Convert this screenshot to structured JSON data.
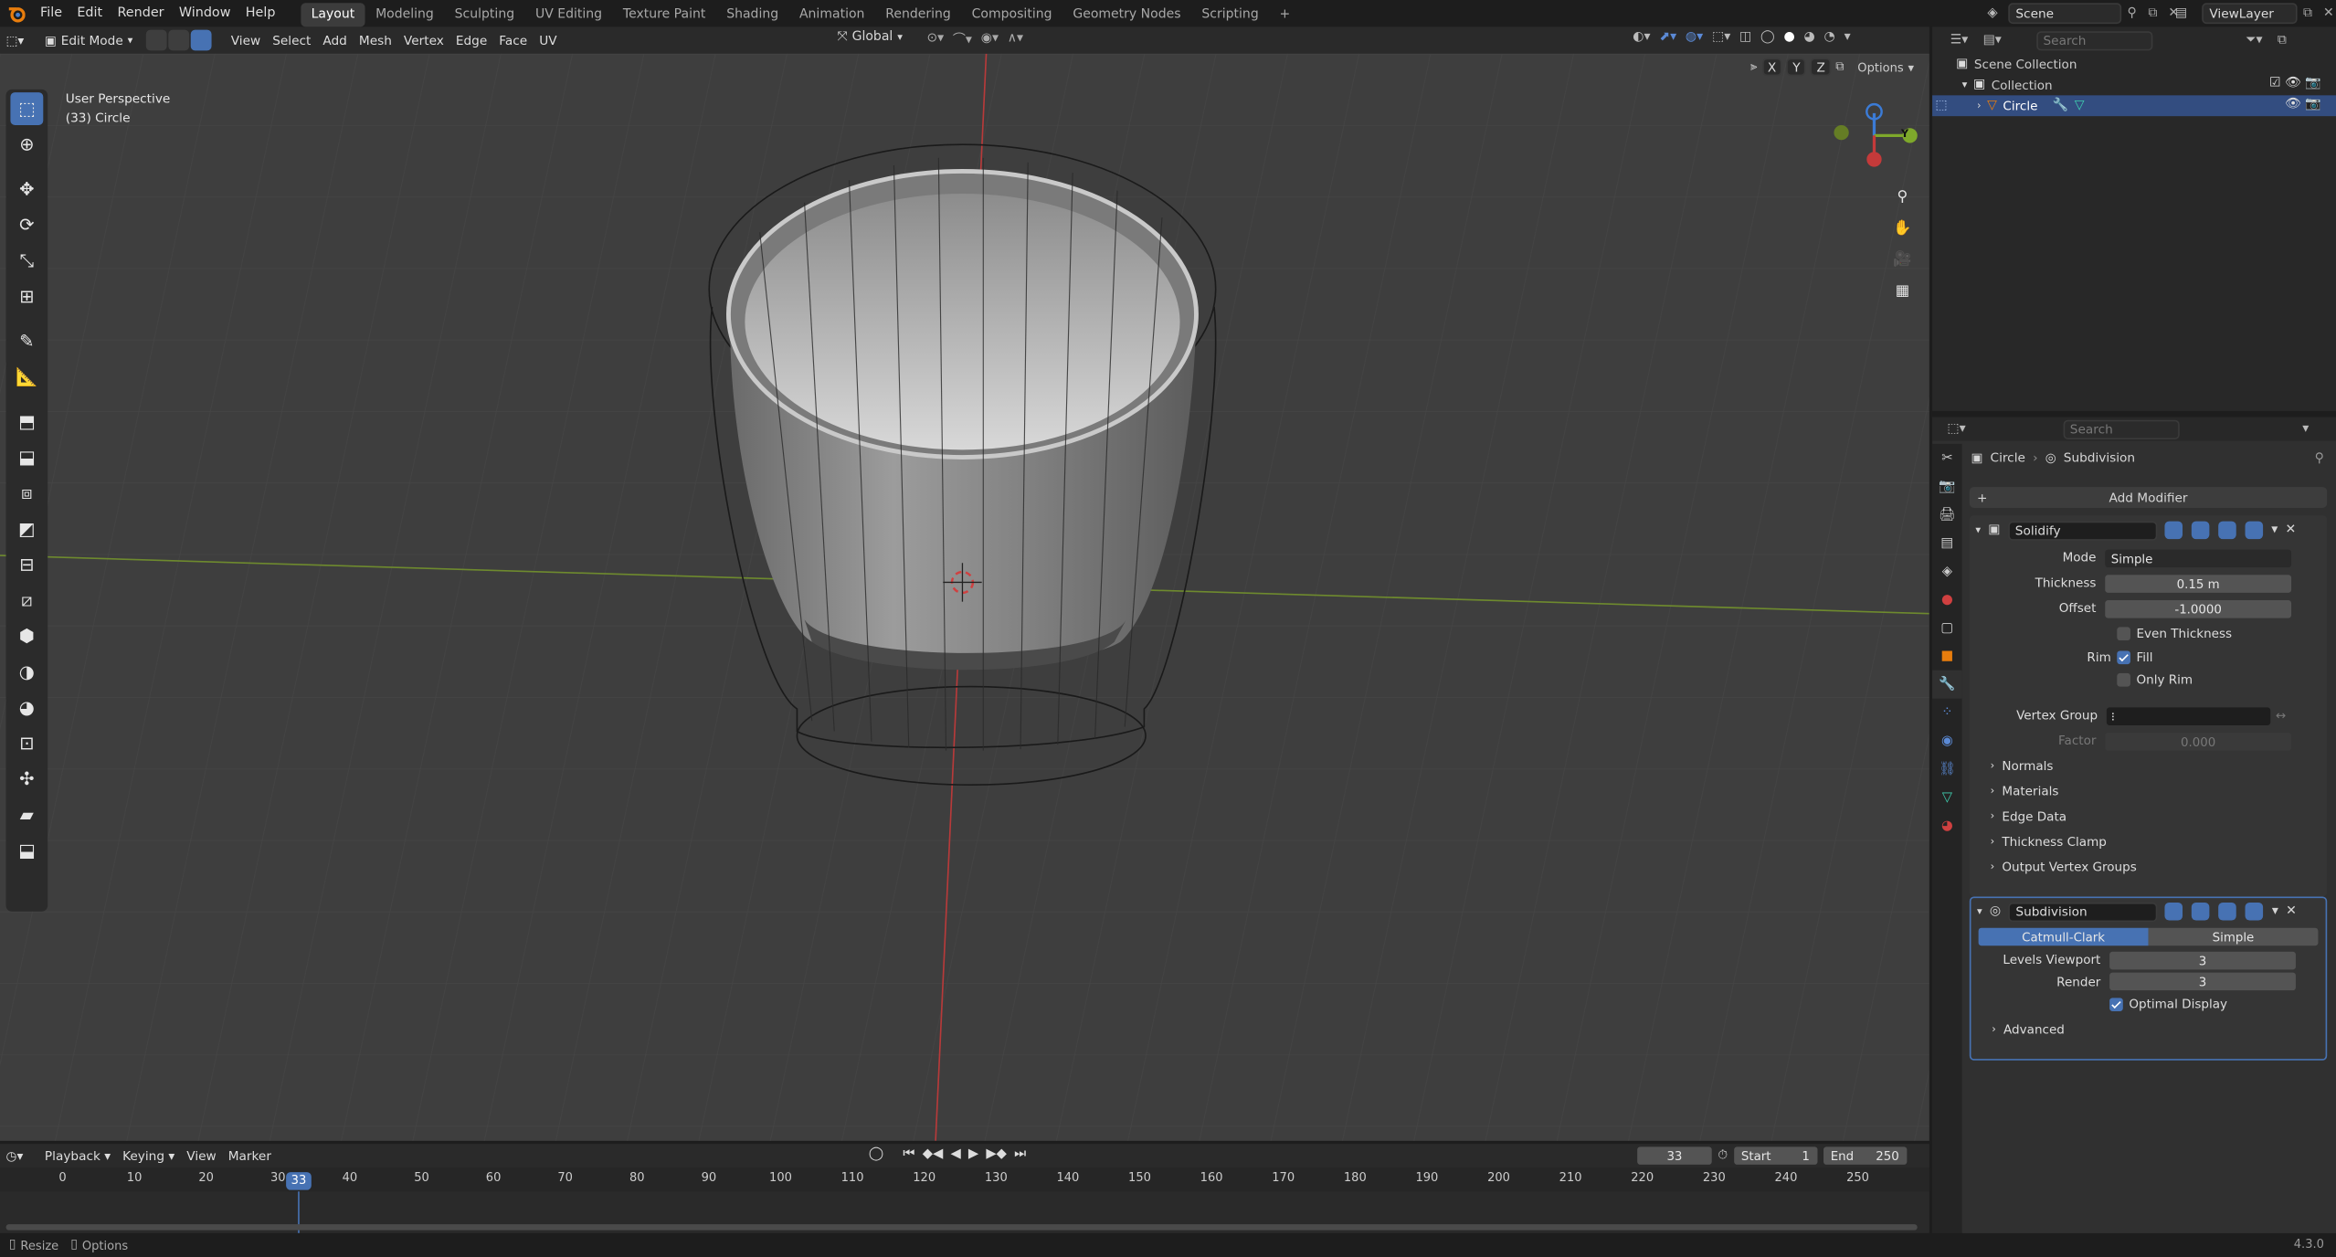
{
  "menus": [
    "File",
    "Edit",
    "Render",
    "Window",
    "Help"
  ],
  "workspaces": [
    "Layout",
    "Modeling",
    "Sculpting",
    "UV Editing",
    "Texture Paint",
    "Shading",
    "Animation",
    "Rendering",
    "Compositing",
    "Geometry Nodes",
    "Scripting"
  ],
  "active_workspace": "Layout",
  "scene": {
    "name": "Scene",
    "view_layer": "ViewLayer"
  },
  "viewport_header": {
    "mode": "Edit Mode",
    "menus": [
      "View",
      "Select",
      "Add",
      "Mesh",
      "Vertex",
      "Edge",
      "Face",
      "UV"
    ],
    "transform": "Global",
    "options": "Options",
    "axes": [
      "X",
      "Y",
      "Z"
    ]
  },
  "viewport": {
    "line1": "User Perspective",
    "line2": "(33) Circle",
    "gizmo_y": "Y"
  },
  "outliner": {
    "search_placeholder": "Search",
    "items": [
      {
        "label": "Scene Collection"
      },
      {
        "label": "Collection"
      },
      {
        "label": "Circle"
      }
    ]
  },
  "properties": {
    "search_placeholder": "Search",
    "breadcrumb_object": "Circle",
    "breadcrumb_modifier": "Subdivision",
    "add_modifier": "Add Modifier",
    "solidify": {
      "name": "Solidify",
      "mode_label": "Mode",
      "mode_value": "Simple",
      "thickness_label": "Thickness",
      "thickness_value": "0.15 m",
      "offset_label": "Offset",
      "offset_value": "-1.0000",
      "even_thickness": "Even Thickness",
      "rim_label": "Rim",
      "fill": "Fill",
      "only_rim": "Only Rim",
      "vertex_group_label": "Vertex Group",
      "factor_label": "Factor",
      "factor_value": "0.000",
      "panels": [
        "Normals",
        "Materials",
        "Edge Data",
        "Thickness Clamp",
        "Output Vertex Groups"
      ]
    },
    "subdivision": {
      "name": "Subdivision",
      "tab_catmull": "Catmull-Clark",
      "tab_simple": "Simple",
      "levels_viewport_label": "Levels Viewport",
      "levels_viewport_value": "3",
      "render_label": "Render",
      "render_value": "3",
      "optimal_display": "Optimal Display",
      "advanced": "Advanced"
    }
  },
  "timeline": {
    "menus": [
      "Playback",
      "Keying",
      "View",
      "Marker"
    ],
    "current_frame": "33",
    "start_label": "Start",
    "start_value": "1",
    "end_label": "End",
    "end_value": "250",
    "ticks": [
      "0",
      "10",
      "20",
      "30",
      "40",
      "50",
      "60",
      "70",
      "80",
      "90",
      "100",
      "110",
      "120",
      "130",
      "140",
      "150",
      "160",
      "170",
      "180",
      "190",
      "200",
      "210",
      "220",
      "230",
      "240",
      "250"
    ]
  },
  "status": {
    "left1": "Resize",
    "left2": "Options",
    "version": "4.3.0"
  },
  "colors": {
    "accent": "#4772b3",
    "x_axis": "#c43a3a",
    "y_axis": "#7ea82b",
    "z_axis": "#3b7bd6"
  }
}
